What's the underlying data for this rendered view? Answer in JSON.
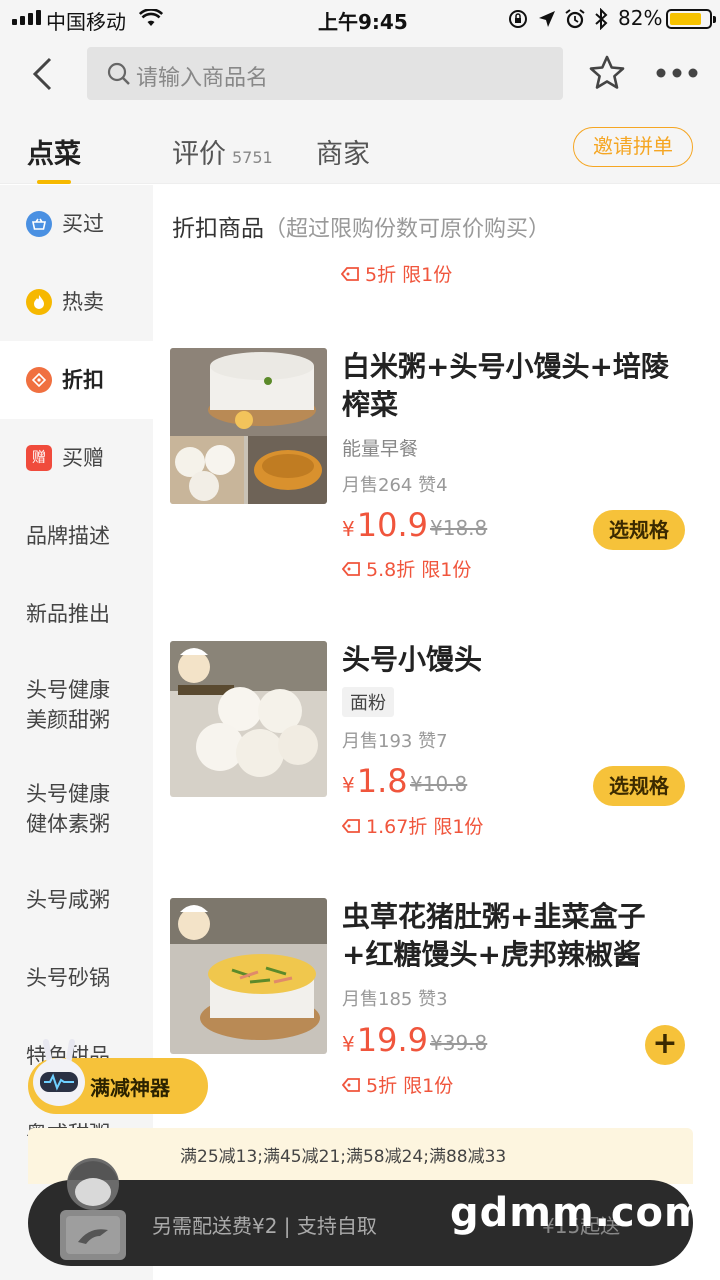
{
  "status_bar": {
    "carrier": "中国移动",
    "time": "上午9:45",
    "battery_pct": "82%",
    "battery_level": 0.82
  },
  "nav": {
    "search_placeholder": "请输入商品名"
  },
  "tabs": {
    "order": "点菜",
    "reviews": "评价",
    "reviews_count": "5751",
    "merchant": "商家",
    "invite": "邀请拼单"
  },
  "sidebar": {
    "items": [
      {
        "label": "买过",
        "icon": "basket-icon"
      },
      {
        "label": "热卖",
        "icon": "flame-icon"
      },
      {
        "label": "折扣",
        "icon": "discount-tag-icon"
      },
      {
        "label": "买赠",
        "icon": "gift-icon",
        "icon_text": "赠"
      },
      {
        "label": "品牌描述"
      },
      {
        "label": "新品推出"
      },
      {
        "label": "头号健康\n美颜甜粥"
      },
      {
        "label": "头号健康\n健体素粥"
      },
      {
        "label": "头号咸粥"
      },
      {
        "label": "头号砂锅"
      },
      {
        "label": "特色甜品"
      },
      {
        "label": "粤式甜粥"
      }
    ]
  },
  "section": {
    "title": "折扣商品",
    "note": "（超过限购份数可原价购买）",
    "top_discount": "5折  限1份"
  },
  "products": [
    {
      "name": "白米粥+头号小馒头+培陵榨菜",
      "subtitle": "能量早餐",
      "sales": "月售264   赞4",
      "yen": "¥",
      "price": "10.9",
      "original": "¥18.8",
      "discount": "5.8折  限1份",
      "action": "选规格"
    },
    {
      "name": "头号小馒头",
      "badge": "面粉",
      "sales": "月售193   赞7",
      "yen": "¥",
      "price": "1.8",
      "original": "¥10.8",
      "discount": "1.67折  限1份",
      "action": "选规格"
    },
    {
      "name": "虫草花猪肚粥+韭菜盒子+红糖馒头+虎邦辣椒酱",
      "sales": "月售185   赞3",
      "yen": "¥",
      "price": "19.9",
      "original": "¥39.8",
      "discount": "5折  限1份",
      "action": "+"
    }
  ],
  "bottom": {
    "promo_button": "满减神器",
    "discount_rules": "满25减13;满45减21;满58减24;满88减33",
    "shipping": "另需配送费¥2 | 支持自取",
    "min_order": "¥15起送",
    "watermark": "gdmm.com"
  },
  "colors": {
    "accent_yellow": "#f6c23a",
    "price_red": "#f0553c",
    "invite_orange": "#f5a623",
    "cart_bar": "#2b2b2b"
  }
}
